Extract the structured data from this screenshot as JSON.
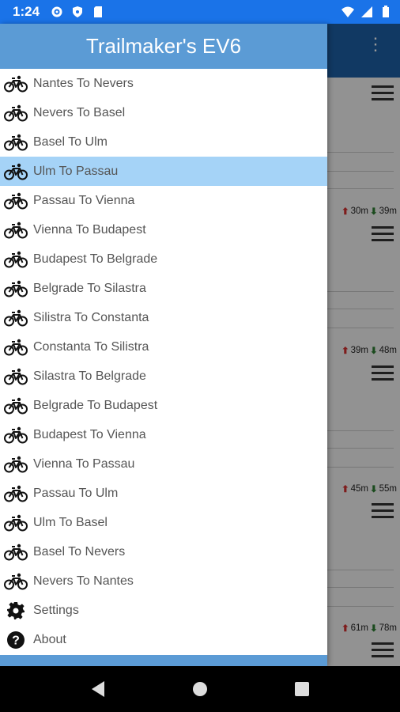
{
  "status_bar": {
    "time": "1:24",
    "left_icons": [
      "gear-icon",
      "shield-icon",
      "sd-card-icon"
    ],
    "right_icons": [
      "wifi-icon",
      "signal-icon",
      "battery-icon"
    ],
    "color": "#1a73e8"
  },
  "drawer": {
    "title": "Trailmaker's EV6",
    "header_color": "#5b9bd5",
    "selected_color": "#a5d3f7",
    "items": [
      {
        "label": "Nantes To Nevers",
        "icon": "bicycle-icon"
      },
      {
        "label": "Nevers To Basel",
        "icon": "bicycle-icon"
      },
      {
        "label": "Basel To Ulm",
        "icon": "bicycle-icon"
      },
      {
        "label": "Ulm To Passau",
        "icon": "bicycle-icon",
        "selected": true
      },
      {
        "label": "Passau To Vienna",
        "icon": "bicycle-icon"
      },
      {
        "label": "Vienna To Budapest",
        "icon": "bicycle-icon"
      },
      {
        "label": "Budapest To Belgrade",
        "icon": "bicycle-icon"
      },
      {
        "label": "Belgrade To Silastra",
        "icon": "bicycle-icon"
      },
      {
        "label": "Silistra To Constanta",
        "icon": "bicycle-icon"
      },
      {
        "label": "Constanta To Silistra",
        "icon": "bicycle-icon"
      },
      {
        "label": "Silastra To Belgrade",
        "icon": "bicycle-icon"
      },
      {
        "label": "Belgrade To Budapest",
        "icon": "bicycle-icon"
      },
      {
        "label": "Budapest To Vienna",
        "icon": "bicycle-icon"
      },
      {
        "label": "Vienna To Passau",
        "icon": "bicycle-icon"
      },
      {
        "label": "Passau To Ulm",
        "icon": "bicycle-icon"
      },
      {
        "label": "Ulm To Basel",
        "icon": "bicycle-icon"
      },
      {
        "label": "Basel To Nevers",
        "icon": "bicycle-icon"
      },
      {
        "label": "Nevers To Nantes",
        "icon": "bicycle-icon"
      },
      {
        "label": "Settings",
        "icon": "settings-icon"
      },
      {
        "label": "About",
        "icon": "help-icon"
      }
    ]
  },
  "background": {
    "app_bar_color": "#1d5fa6",
    "stages": [
      {
        "up": "30m",
        "down": "39m"
      },
      {
        "up": "39m",
        "down": "48m"
      },
      {
        "up": "45m",
        "down": "55m"
      },
      {
        "up": "61m",
        "down": "78m"
      }
    ]
  },
  "nav_bar": {
    "buttons": [
      "back-icon",
      "home-icon",
      "recents-icon"
    ]
  }
}
